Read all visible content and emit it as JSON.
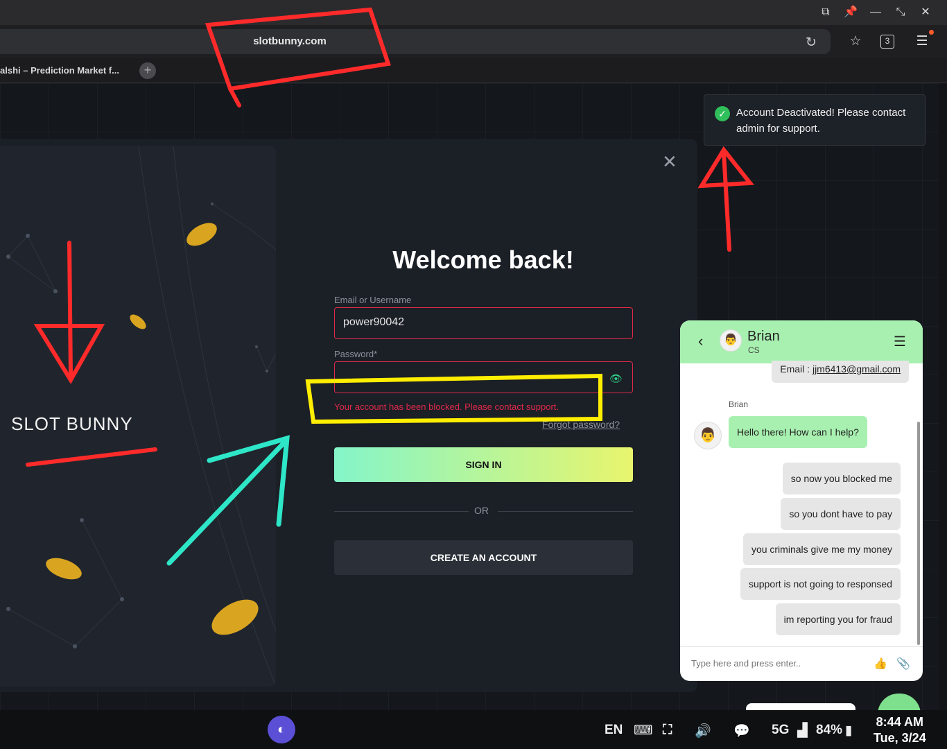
{
  "browser": {
    "url": "slotbunny.com",
    "tab_title": "alshi – Prediction Market f...",
    "tab_count": "3"
  },
  "toast": {
    "message": "Account Deactivated! Please contact admin for support."
  },
  "login": {
    "brand": "SLOT BUNNY",
    "title": "Welcome back!",
    "email_label": "Email or Username",
    "email_value": "power90042",
    "password_label": "Password*",
    "error": "Your account has been blocked. Please contact support.",
    "forgot": "Forgot password?",
    "signin": "SIGN IN",
    "or": "OR",
    "create": "CREATE AN ACCOUNT"
  },
  "chat": {
    "agent_name": "Brian",
    "agent_role": "CS",
    "email_line_prefix": "Email : ",
    "email_address": "jjm6413@gmail.com",
    "agent_label": "Brian",
    "agent_message": "Hello there! How can I help?",
    "user_messages": [
      "so now you blocked me",
      "so you dont have to pay",
      "you criminals give me my money",
      "support is not going to responsed",
      "im reporting you for fraud"
    ],
    "input_placeholder": "Type here and press enter.."
  },
  "taskbar": {
    "lang": "EN",
    "network": "5G",
    "battery": "84%",
    "time": "8:44 AM",
    "date": "Tue, 3/24"
  },
  "colors": {
    "accent_green": "#a8f0b0",
    "error_red": "#e0294a",
    "signin_gradient_start": "#84f5c9",
    "signin_gradient_end": "#e8f56d"
  }
}
